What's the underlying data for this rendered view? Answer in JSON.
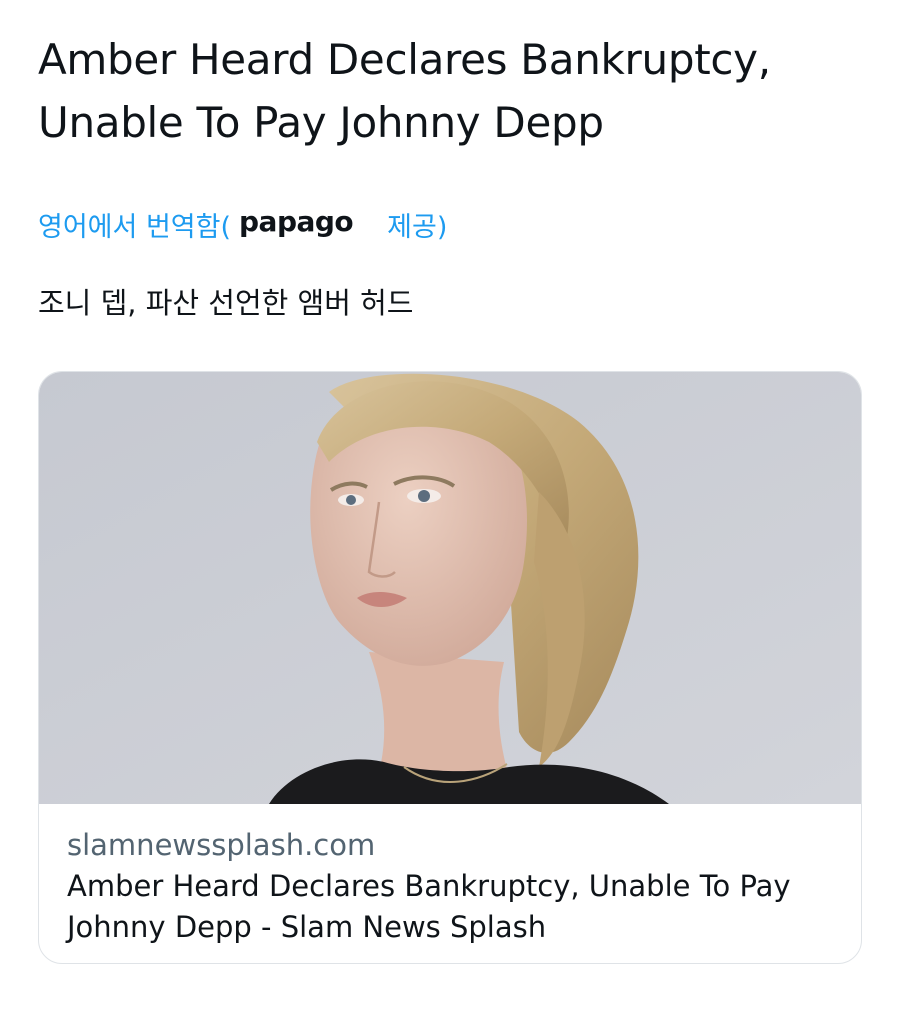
{
  "tweet": {
    "text": "Amber Heard Declares Bankruptcy, Unable To Pay Johnny Depp"
  },
  "translation": {
    "label_prefix": "영어에서 번역함(",
    "provider": "papago",
    "label_suffix": "제공)",
    "translated_text": "조니 뎁, 파산 선언한 앰버 허드"
  },
  "link_card": {
    "image_icon": "portrait-photo",
    "domain": "slamnewssplash.com",
    "title": "Amber Heard Declares Bankruptcy, Unable To Pay Johnny Depp - Slam News Splash"
  },
  "colors": {
    "link_blue": "#1d9bf0",
    "text_primary": "#0f1419",
    "text_secondary": "#536471",
    "card_border": "#dfe3e7",
    "photo_background": "#c9ccd3"
  }
}
